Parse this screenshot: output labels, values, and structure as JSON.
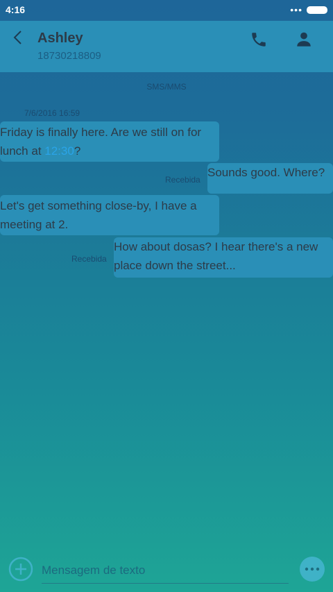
{
  "status_bar": {
    "time": "4:16",
    "dots": "•••"
  },
  "header": {
    "contact_name": "Ashley",
    "contact_number": "18730218809"
  },
  "conversation": {
    "channel_label": "SMS/MMS",
    "date_label": "7/6/2016 16:59",
    "messages": [
      {
        "direction": "incoming",
        "text_before": "Friday is finally here. Are we still on for lunch at ",
        "link": "12:30",
        "text_after": "?"
      },
      {
        "direction": "outgoing",
        "text": "Sounds good. Where?",
        "status": "Recebida"
      },
      {
        "direction": "incoming",
        "text": "Let's get something close-by, I have a meeting at 2."
      },
      {
        "direction": "outgoing",
        "text": "How about dosas? I hear there's a new place down the street...",
        "status": "Recebida"
      }
    ]
  },
  "compose": {
    "placeholder": "Mensagem de texto"
  },
  "colors": {
    "header_bg": "#2a8fb7",
    "bubble_bg": "#2a8fb7",
    "link": "#2aa4e8",
    "text": "#2d3b48"
  },
  "icons": [
    "back-arrow-icon",
    "phone-icon",
    "contact-icon",
    "add-icon",
    "more-icon"
  ]
}
